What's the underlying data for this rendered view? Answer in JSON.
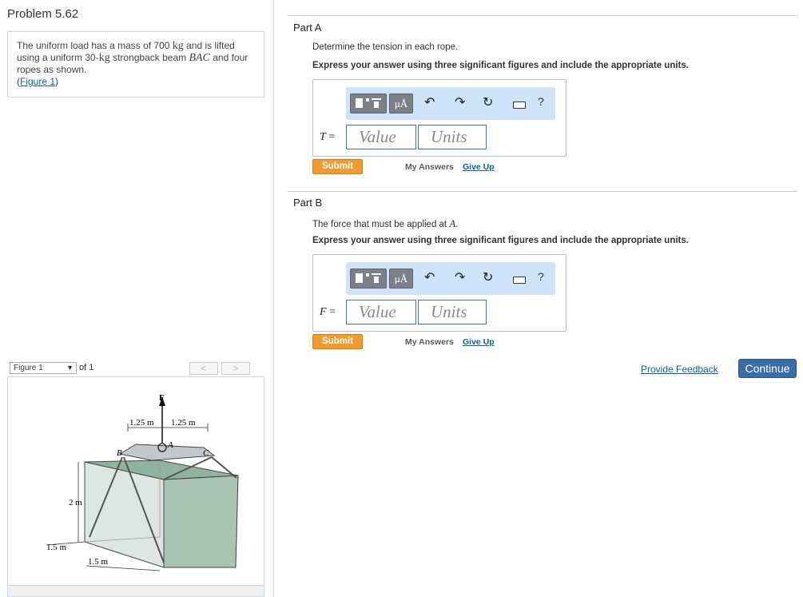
{
  "problem": {
    "title": "Problem 5.62",
    "text_1": "The uniform load has a mass of 700 ",
    "unit_kg": "kg",
    "text_2": " and is lifted using a uniform 30-",
    "unit_kg2": "kg",
    "text_3": " strongback beam ",
    "beam": "BAC",
    "text_4": " and four ropes as shown.",
    "figure_link_open": "(",
    "figure_link": "Figure 1",
    "figure_link_close": ")"
  },
  "figure_viewer": {
    "selected": "Figure 1",
    "of_label": "of 1",
    "prev": "<",
    "next": ">",
    "labels": {
      "force": "F",
      "dim_left": "1.25 m",
      "dim_right": "1.25 m",
      "point_a": "A",
      "point_b": "B",
      "point_c": "C",
      "height": "2 m",
      "depth": "1.5 m",
      "width": "1.5 m"
    }
  },
  "part_a": {
    "label": "Part A",
    "question": "Determine the tension in each rope.",
    "instruction": "Express your answer using three significant figures and include the appropriate units.",
    "variable": "T",
    "equals": " =",
    "value_placeholder": "Value",
    "units_placeholder": "Units",
    "submit": "Submit",
    "my_answers": "My Answers",
    "give_up": "Give Up"
  },
  "part_b": {
    "label": "Part B",
    "question_1": "The force that must be applied at ",
    "point": "A",
    "question_2": ".",
    "instruction": "Express your answer using three significant figures and include the appropriate units.",
    "variable": "F",
    "equals": " =",
    "value_placeholder": "Value",
    "units_placeholder": "Units",
    "submit": "Submit",
    "my_answers": "My Answers",
    "give_up": "Give Up"
  },
  "toolbar": {
    "mu_label": "μÅ",
    "undo": "↶",
    "redo": "↷",
    "reset": "↻",
    "help": "?"
  },
  "footer": {
    "feedback": "Provide Feedback",
    "continue": "Continue"
  },
  "colors": {
    "accent_blue": "#0e5ca8",
    "submit_orange": "#f29a2e",
    "toolbar_bg": "#cfe3fa",
    "continue_bg": "#3a6ea8"
  }
}
